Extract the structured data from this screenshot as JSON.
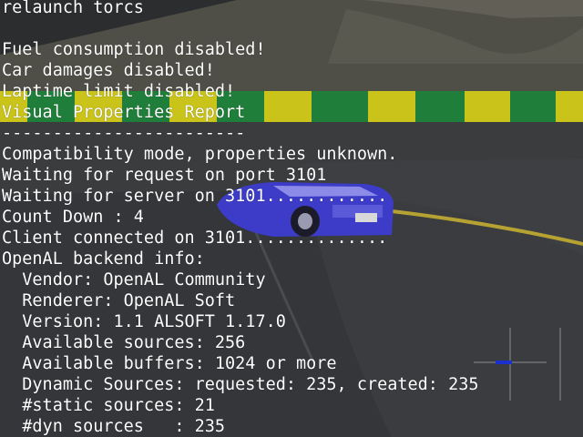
{
  "console": {
    "lines": [
      "relaunch torcs",
      "",
      "Fuel consumption disabled!",
      "Car damages disabled!",
      "Laptime limit disabled!",
      "Visual Properties Report",
      "------------------------",
      "Compatibility mode, properties unknown.",
      "Waiting for request on port 3101",
      "Waiting for server on 3101............",
      "Count Down : 4",
      "Client connected on 3101..............",
      "OpenAL backend info:",
      "  Vendor: OpenAL Community",
      "  Renderer: OpenAL Soft",
      "  Version: 1.1 ALSOFT 1.17.0",
      "  Available sources: 256",
      "  Available buffers: 1024 or more",
      "  Dynamic Sources: requested: 235, created: 235",
      "  #static sources: 21",
      "  #dyn sources   : 235"
    ],
    "text_color": "#ffffff"
  },
  "scene": {
    "elements": [
      "sky-background",
      "grass-field",
      "track-barrier",
      "race-track",
      "track-curb",
      "race-car",
      "minimap"
    ],
    "colors": {
      "grass": "#4f4f47",
      "barrier_yellow": "#c9c31a",
      "barrier_green": "#1f7f3a",
      "track": "#3c3d3f",
      "curb_yellow": "#b5a232",
      "car_body": "#3c3cc8",
      "minimap_marker": "#1a2fd0"
    }
  }
}
